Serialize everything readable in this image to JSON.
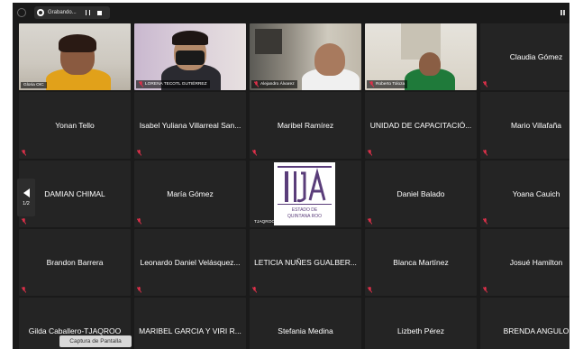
{
  "topbar": {
    "recording_label": "Grabando...",
    "icons": [
      "security-icon",
      "record-icon",
      "pause-icon",
      "stop-icon",
      "grid-view-icon"
    ]
  },
  "navigation": {
    "page": "1/2"
  },
  "tiles": [
    {
      "name": "Gloria OIC",
      "video": true,
      "talking": true
    },
    {
      "name": "LORENA TECOTL GUTIÉRREZ",
      "video": true
    },
    {
      "name": "Alejandro Álvarez",
      "video": true
    },
    {
      "name": "Roberto Toloza",
      "video": true
    },
    {
      "name": "Claudia Gómez"
    },
    {
      "name": "Yonan Tello"
    },
    {
      "name": "Isabel Yuliana Villarreal San..."
    },
    {
      "name": "Maribel Ramírez"
    },
    {
      "name": "UNIDAD DE CAPACITACIÓ..."
    },
    {
      "name": "Mario Villafaña"
    },
    {
      "name": "DAMIAN CHIMAL"
    },
    {
      "name": "María Gómez"
    },
    {
      "name": "TJAQROO",
      "logo": true
    },
    {
      "name": "Daniel Balado"
    },
    {
      "name": "Yoana Cauich"
    },
    {
      "name": "Brandon Barrera"
    },
    {
      "name": "Leonardo Daniel Velásquez..."
    },
    {
      "name": "LETICIA NUÑES GUALBER..."
    },
    {
      "name": "Blanca Martínez"
    },
    {
      "name": "Josué Hamilton"
    },
    {
      "name": "Gilda Caballero-TJAQROO"
    },
    {
      "name": "MARIBEL GARCIA Y VIRI R..."
    },
    {
      "name": "Stefania Medina"
    },
    {
      "name": "Lizbeth Pérez"
    },
    {
      "name": "BRENDA ANGULO"
    }
  ],
  "logo": {
    "line1": "ESTADO DE",
    "line2": "QUINTANA ROO"
  },
  "tooltip": "Captura de Pantalla",
  "colors": {
    "talking_outline": "#d4e84a",
    "mute_icon": "#e0304a",
    "tile_bg": "#242424",
    "logo_purple": "#5a3d7a"
  }
}
